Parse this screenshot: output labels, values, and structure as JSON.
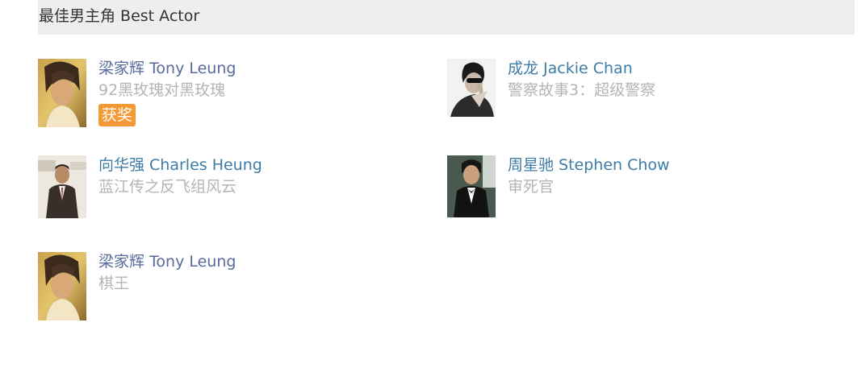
{
  "award": {
    "title": "最佳男主角 Best Actor"
  },
  "colors": {
    "header_bg": "#eeeeee",
    "name_link": "#3e7ca6",
    "name_link_alt": "#5a6a9c",
    "film_text": "#b5b5b5",
    "winner_badge": "#f39a36"
  },
  "nominees": [
    {
      "name": "梁家辉 Tony Leung",
      "film": "92黑玫瑰对黑玫瑰",
      "winner_label": "获奖",
      "photo": "tony-leung-portrait"
    },
    {
      "name": "成龙 Jackie Chan",
      "film": "警察故事3：超级警察",
      "photo": "jackie-chan-portrait"
    },
    {
      "name": "向华强 Charles Heung",
      "film": "蓝江传之反飞组风云",
      "photo": "charles-heung-portrait"
    },
    {
      "name": "周星驰 Stephen Chow",
      "film": "审死官",
      "photo": "stephen-chow-portrait"
    },
    {
      "name": "梁家辉 Tony Leung",
      "film": "棋王",
      "photo": "tony-leung-portrait"
    }
  ]
}
